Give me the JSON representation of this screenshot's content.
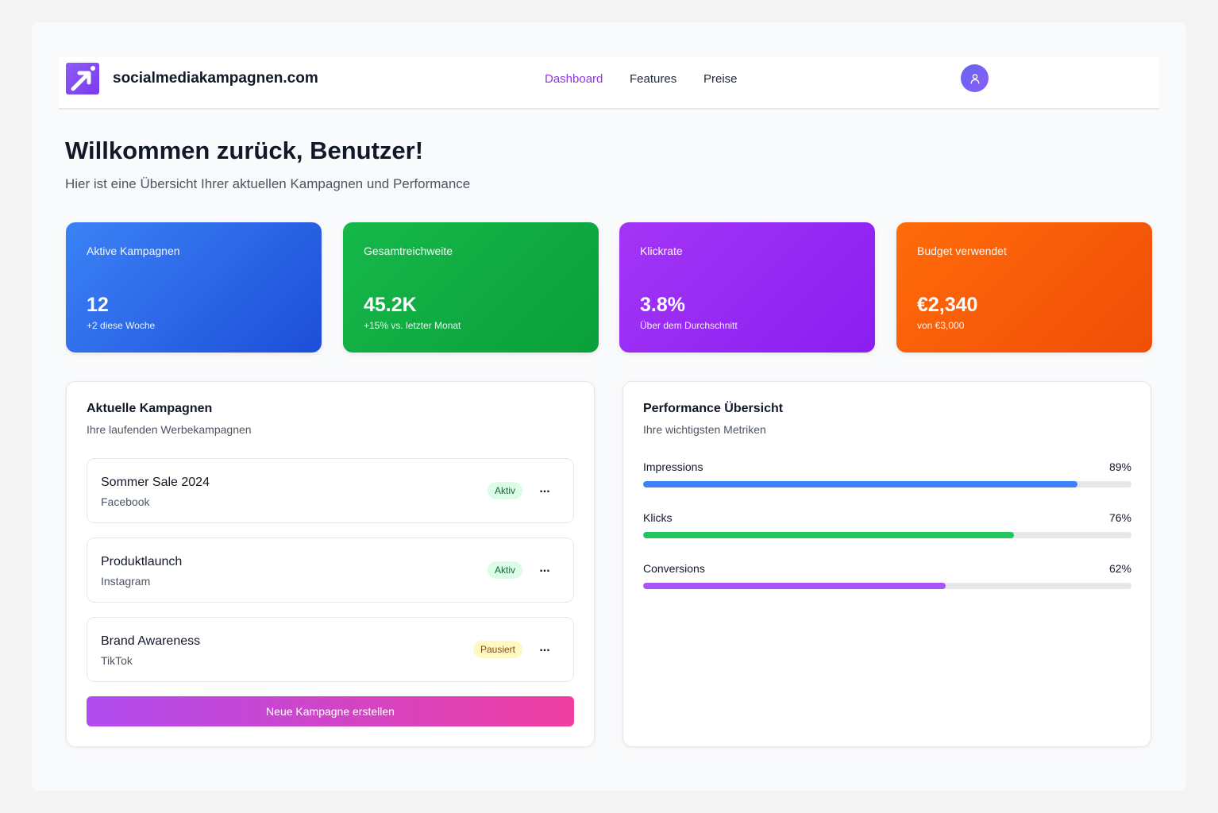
{
  "header": {
    "brand": "socialmediakampagnen.com",
    "nav": [
      {
        "label": "Dashboard",
        "active": true
      },
      {
        "label": "Features",
        "active": false
      },
      {
        "label": "Preise",
        "active": false
      }
    ],
    "avatar_icon": "user-icon"
  },
  "welcome": {
    "title": "Willkommen zurück, Benutzer!",
    "subtitle": "Hier ist eine Übersicht Ihrer aktuellen Kampagnen und Performance"
  },
  "stats": [
    {
      "label": "Aktive Kampagnen",
      "value": "12",
      "note": "+2 diese Woche",
      "color": "#2563eb"
    },
    {
      "label": "Gesamtreichweite",
      "value": "45.2K",
      "note": "+15% vs. letzter Monat",
      "color": "#16a34a"
    },
    {
      "label": "Klickrate",
      "value": "3.8%",
      "note": "Über dem Durchschnitt",
      "color": "#9333ea"
    },
    {
      "label": "Budget verwendet",
      "value": "€2,340",
      "note": "von €3,000",
      "color": "#f97316"
    }
  ],
  "campaigns": {
    "title": "Aktuelle Kampagnen",
    "subtitle": "Ihre laufenden Werbekampagnen",
    "items": [
      {
        "name": "Sommer Sale 2024",
        "platform": "Facebook",
        "status": "Aktiv",
        "more": "..."
      },
      {
        "name": "Produktlaunch",
        "platform": "Instagram",
        "status": "Aktiv",
        "more": "..."
      },
      {
        "name": "Brand Awareness",
        "platform": "TikTok",
        "status": "Pausiert",
        "more": "..."
      }
    ],
    "create_button": "Neue Kampagne erstellen"
  },
  "performance": {
    "title": "Performance Übersicht",
    "subtitle": "Ihre wichtigsten Metriken",
    "metrics": [
      {
        "label": "Impressions",
        "value": "89%",
        "percent": 89,
        "color": "#3b82f6"
      },
      {
        "label": "Klicks",
        "value": "76%",
        "percent": 76,
        "color": "#22c55e"
      },
      {
        "label": "Conversions",
        "value": "62%",
        "percent": 62,
        "color": "#a855f7"
      }
    ]
  }
}
